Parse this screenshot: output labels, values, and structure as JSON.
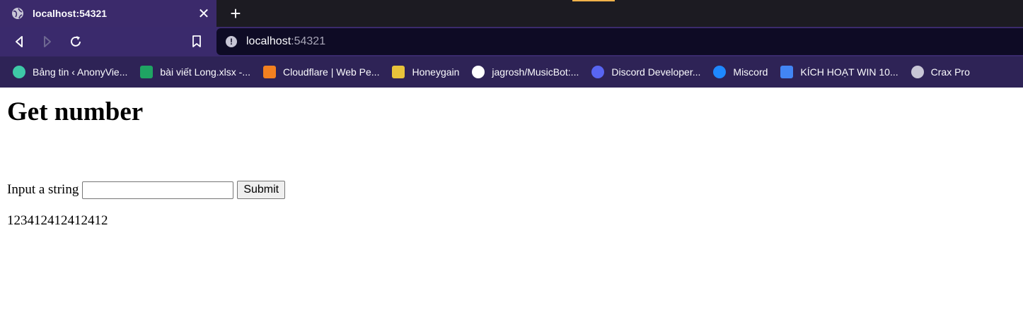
{
  "browser": {
    "tab": {
      "title": "localhost:54321",
      "close": "✕"
    },
    "new_tab": "+",
    "url": {
      "host": "localhost",
      "port": ":54321"
    },
    "bookmarks": [
      {
        "label": "Bảng tin ‹ AnonyVie...",
        "icon": "check-circle-icon",
        "color": "#3ec9a7"
      },
      {
        "label": "bài viết Long.xlsx -...",
        "icon": "sheets-icon",
        "color": "#1fa463"
      },
      {
        "label": "Cloudflare | Web Pe...",
        "icon": "cloud-icon",
        "color": "#f38020"
      },
      {
        "label": "Honeygain",
        "icon": "bee-icon",
        "color": "#e8c33a"
      },
      {
        "label": "jagrosh/MusicBot:...",
        "icon": "github-icon",
        "color": "#ffffff"
      },
      {
        "label": "Discord Developer...",
        "icon": "discord-icon",
        "color": "#5865f2"
      },
      {
        "label": "Miscord",
        "icon": "messenger-icon",
        "color": "#1e88ff"
      },
      {
        "label": "KÍCH HOẠT WIN 10...",
        "icon": "docs-icon",
        "color": "#4285f4"
      },
      {
        "label": "Crax Pro",
        "icon": "globe-icon",
        "color": "#c8c6d6"
      }
    ]
  },
  "page": {
    "title": "Get number",
    "form": {
      "label": "Input a string",
      "input_value": "",
      "submit": "Submit"
    },
    "result": "123412412412412"
  }
}
